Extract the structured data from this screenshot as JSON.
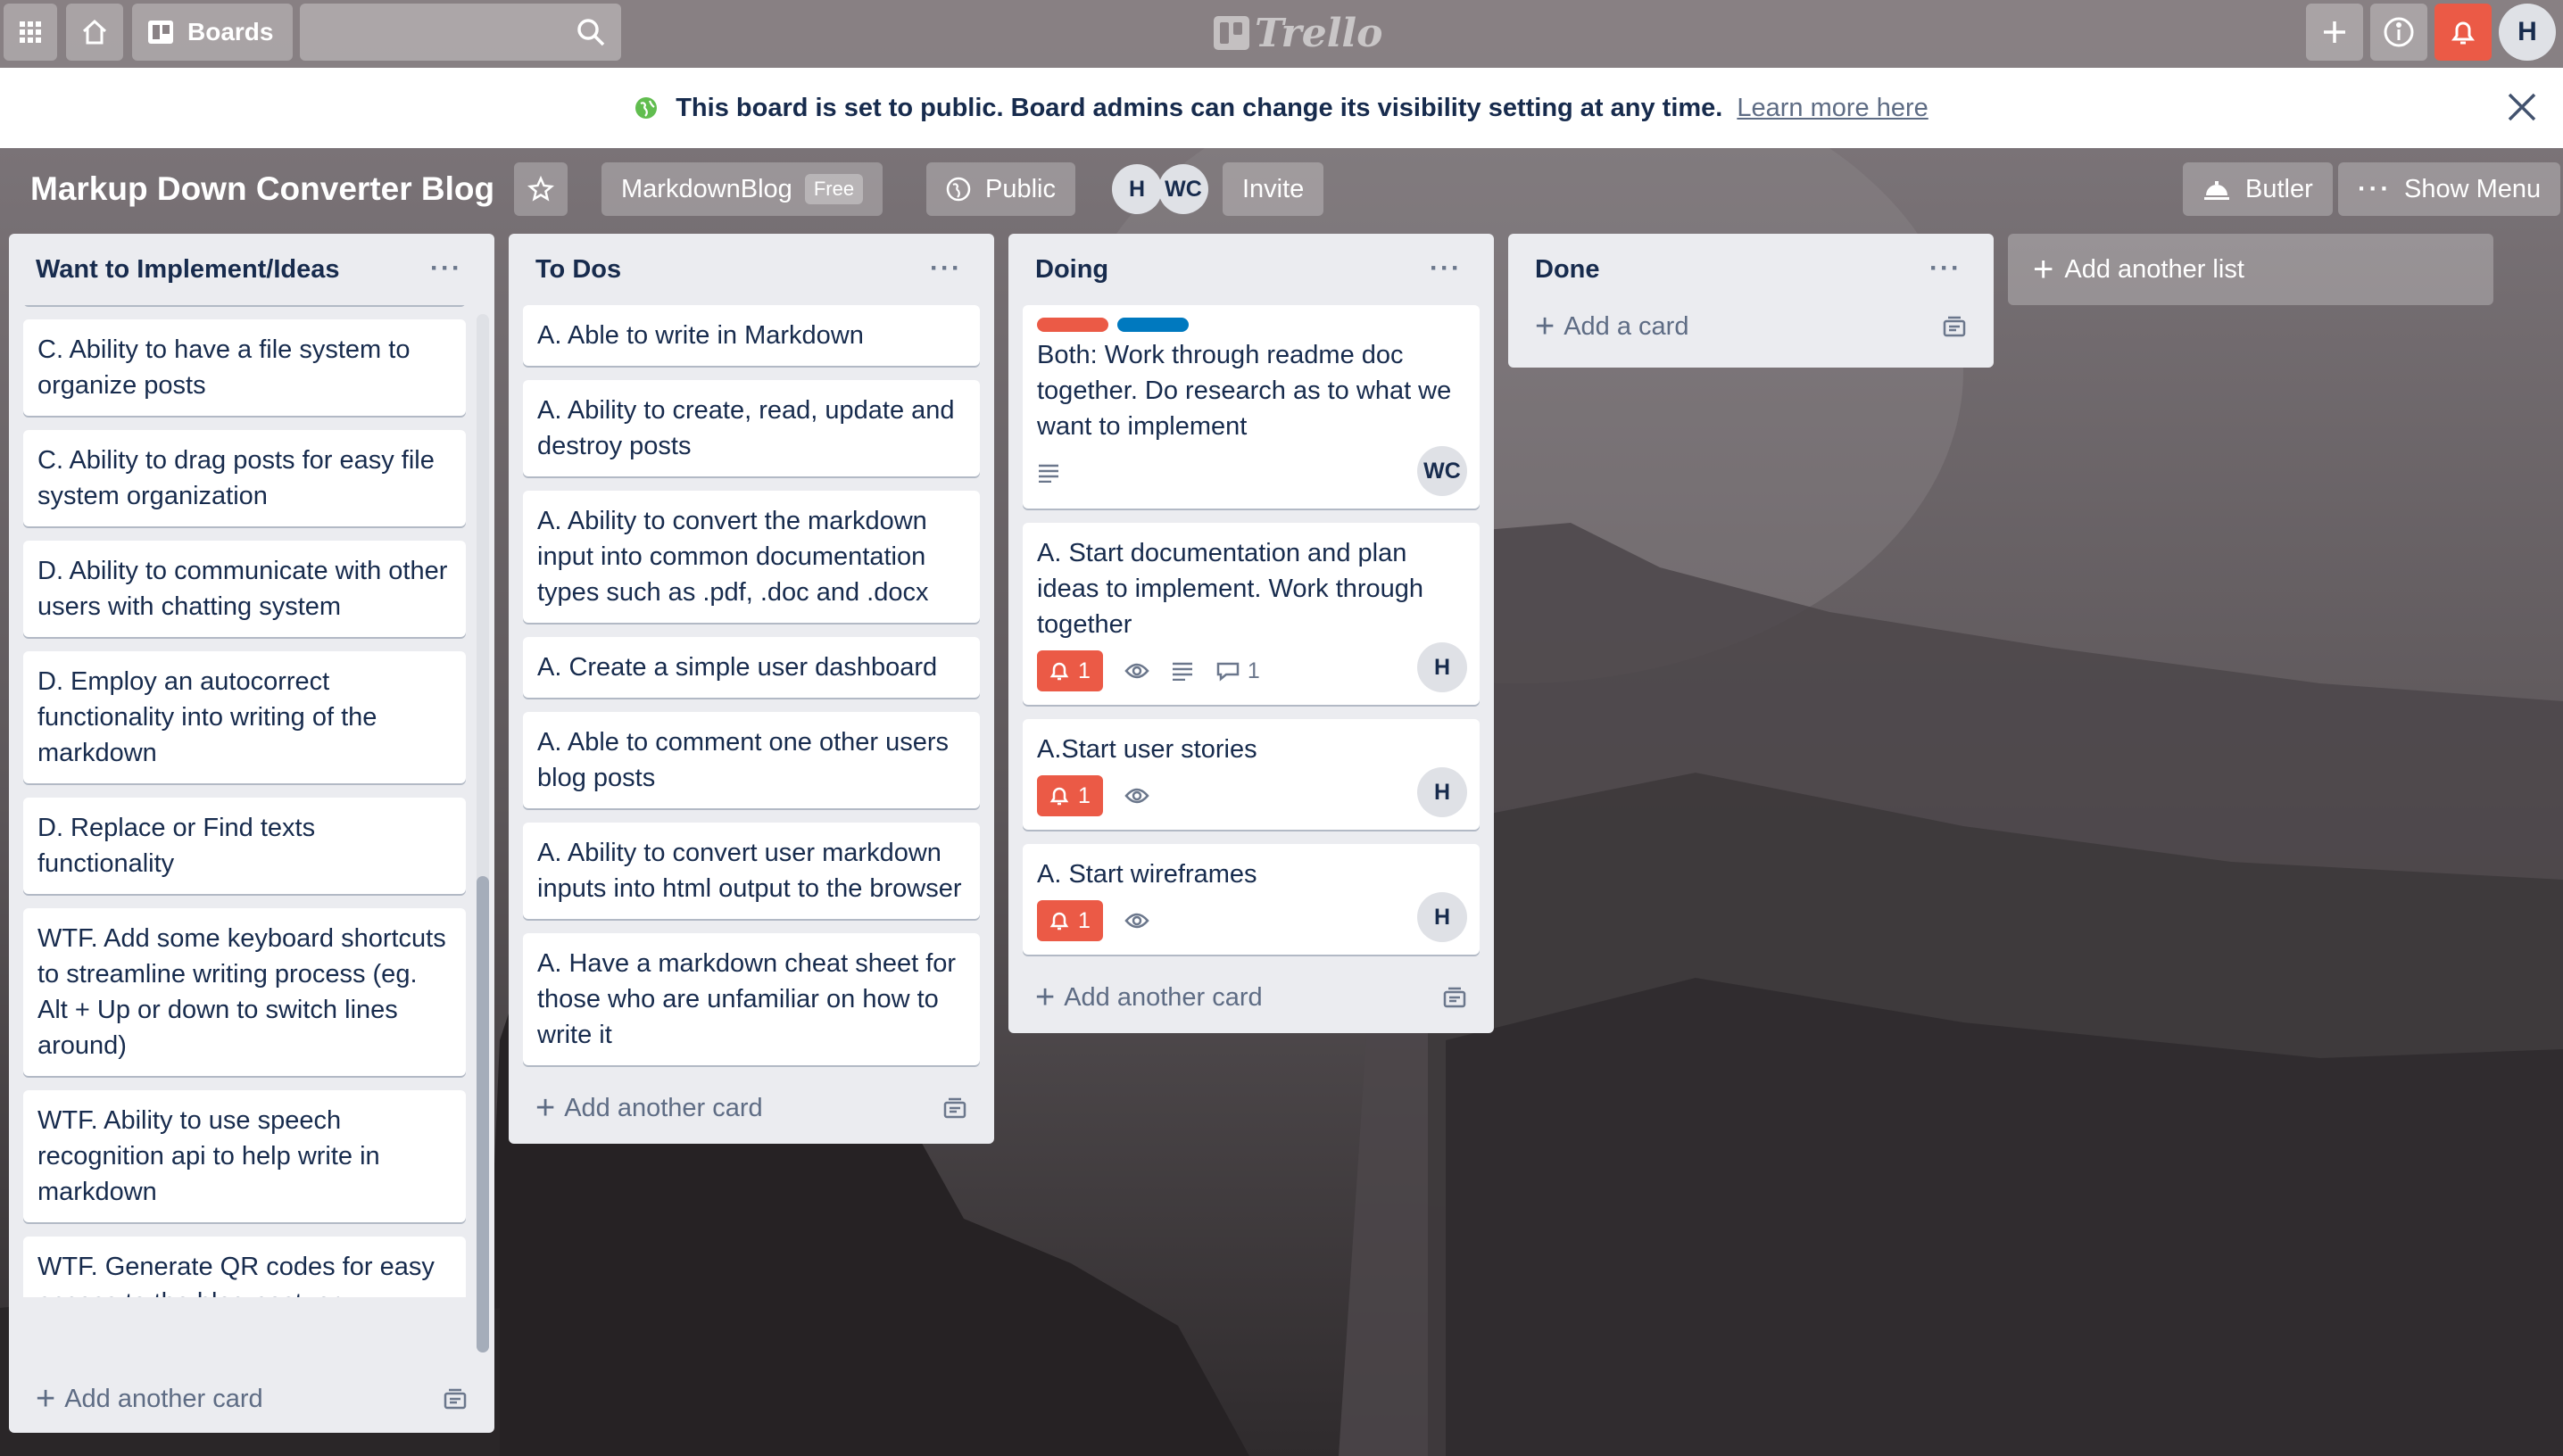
{
  "header": {
    "boards_label": "Boards",
    "search_placeholder": "",
    "logo_text": "Trello",
    "user_initial": "H"
  },
  "banner": {
    "message": "This board is set to public. Board admins can change its visibility setting at any time.",
    "link": "Learn more here"
  },
  "board": {
    "title": "Markup Down Converter Blog",
    "team": "MarkdownBlog",
    "team_badge": "Free",
    "visibility": "Public",
    "members": [
      "H",
      "WC"
    ],
    "invite": "Invite",
    "butler": "Butler",
    "show_menu": "Show Menu"
  },
  "lists": [
    {
      "title": "Want to Implement/Ideas",
      "cards": [
        "C. Ability to have a file system to organize posts",
        "C. Ability to drag posts for easy file system organization",
        "D. Ability to communicate with other users with chatting system",
        "D. Employ an autocorrect functionality into writing of the markdown",
        "D. Replace or Find texts functionality",
        "WTF. Add some keyboard shortcuts to streamline writing process (eg. Alt + Up or down to switch lines around)",
        "WTF. Ability to use speech recognition api to help write in markdown",
        "WTF. Generate QR codes for easy access to the blog post, or authentication"
      ],
      "add_label": "Add another card"
    },
    {
      "title": "To Dos",
      "cards": [
        "A. Able to write in Markdown",
        "A. Ability to create, read, update and destroy posts",
        "A. Ability to convert the markdown input into common documentation types such as .pdf, .doc and .docx",
        "A. Create a simple user dashboard",
        "A. Able to comment one other users blog posts",
        "A. Ability to convert user markdown inputs into html output to the browser",
        "A. Have a markdown cheat sheet for those who are unfamiliar on how to write it"
      ],
      "add_label": "Add another card"
    },
    {
      "title": "Doing",
      "cards": [
        {
          "text": "Both: Work through readme doc together. Do research as to what we want to implement",
          "member": "WC",
          "label_colors": [
            "#eb5a46",
            "#0079bf"
          ]
        },
        {
          "text": "A. Start documentation and plan ideas to implement. Work through together",
          "due": "1",
          "comments": "1",
          "member": "H"
        },
        {
          "text": "A.Start user stories",
          "due": "1",
          "member": "H"
        },
        {
          "text": "A. Start wireframes",
          "due": "1",
          "member": "H"
        }
      ],
      "add_label": "Add another card"
    },
    {
      "title": "Done",
      "cards": [],
      "add_label": "Add a card"
    }
  ],
  "add_list_label": "Add another list",
  "colors": {
    "due_badge": "#eb5a46",
    "list_bg": "#ebecf0",
    "notification": "#eb5a46"
  }
}
